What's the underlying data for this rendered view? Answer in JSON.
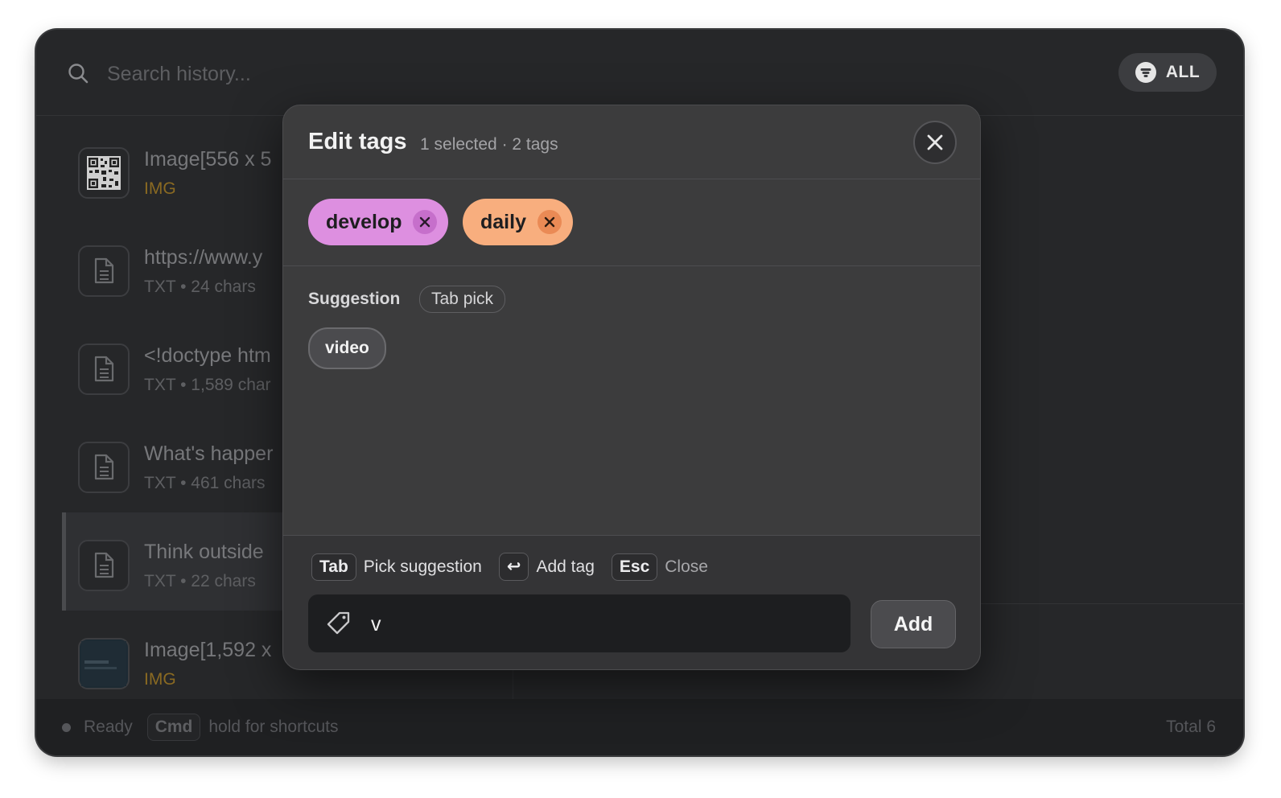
{
  "search": {
    "placeholder": "Search history..."
  },
  "filter": {
    "label": "ALL"
  },
  "items": [
    {
      "title": "Image[556 x 5",
      "meta": "IMG",
      "type": "image"
    },
    {
      "title": "https://www.y",
      "meta": "TXT • 24 chars",
      "type": "text"
    },
    {
      "title": "<!doctype htm",
      "meta": "TXT • 1,589 char",
      "type": "text"
    },
    {
      "title": "What's happer",
      "meta": "TXT • 461 chars",
      "type": "text"
    },
    {
      "title": "Think outside",
      "meta": "TXT • 22 chars",
      "type": "text"
    },
    {
      "title": "Image[1,592 x",
      "meta": "IMG",
      "type": "image"
    }
  ],
  "status": {
    "ready": "Ready",
    "cmd_key": "Cmd",
    "hint": "hold for shortcuts",
    "total": "Total 6"
  },
  "modal": {
    "title": "Edit tags",
    "subtitle": "1 selected · 2 tags",
    "tags": [
      {
        "label": "develop",
        "color": "#dd8fe0"
      },
      {
        "label": "daily",
        "color": "#f8ae7e"
      }
    ],
    "suggestion_label": "Suggestion",
    "tab_pick": "Tab pick",
    "suggestions": [
      "video"
    ],
    "hints": {
      "tab_key": "Tab",
      "tab_text": "Pick suggestion",
      "enter_key": "↩",
      "enter_text": "Add tag",
      "esc_key": "Esc",
      "esc_text": "Close"
    },
    "input_value": "v",
    "add_label": "Add"
  },
  "colors": {
    "accent_caret": "#3478f6",
    "img_meta": "#8a6a22"
  }
}
